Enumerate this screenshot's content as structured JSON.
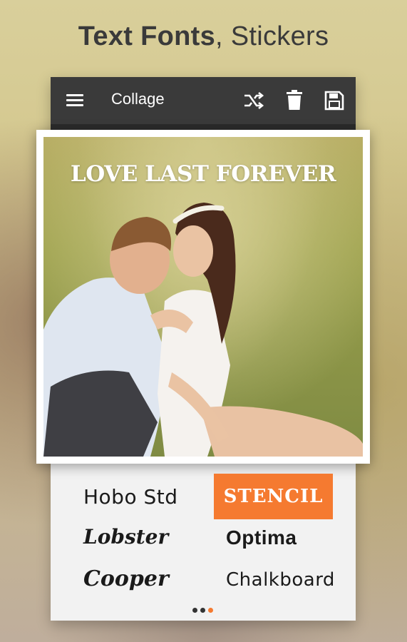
{
  "headline": {
    "bold": "Text Fonts",
    "rest": ", Stickers"
  },
  "toolbar": {
    "title": "Collage"
  },
  "photo": {
    "overlay_text": "LOVE LAST FOREVER"
  },
  "fonts": {
    "items": [
      {
        "label": "Hobo Std",
        "selected": false
      },
      {
        "label": "STENCIL",
        "selected": true
      },
      {
        "label": "Lobster",
        "selected": false
      },
      {
        "label": "Optima",
        "selected": false
      },
      {
        "label": "Cooper",
        "selected": false
      },
      {
        "label": "Chalkboard",
        "selected": false
      }
    ]
  },
  "pagination": {
    "total": 3,
    "active_index": 2
  },
  "colors": {
    "toolbar": "#3a3a3a",
    "accent": "#f57a30",
    "panel": "#f2f2f2"
  },
  "icons": {
    "menu": "menu-icon",
    "shuffle": "shuffle-icon",
    "delete": "trash-icon",
    "save": "save-icon"
  }
}
